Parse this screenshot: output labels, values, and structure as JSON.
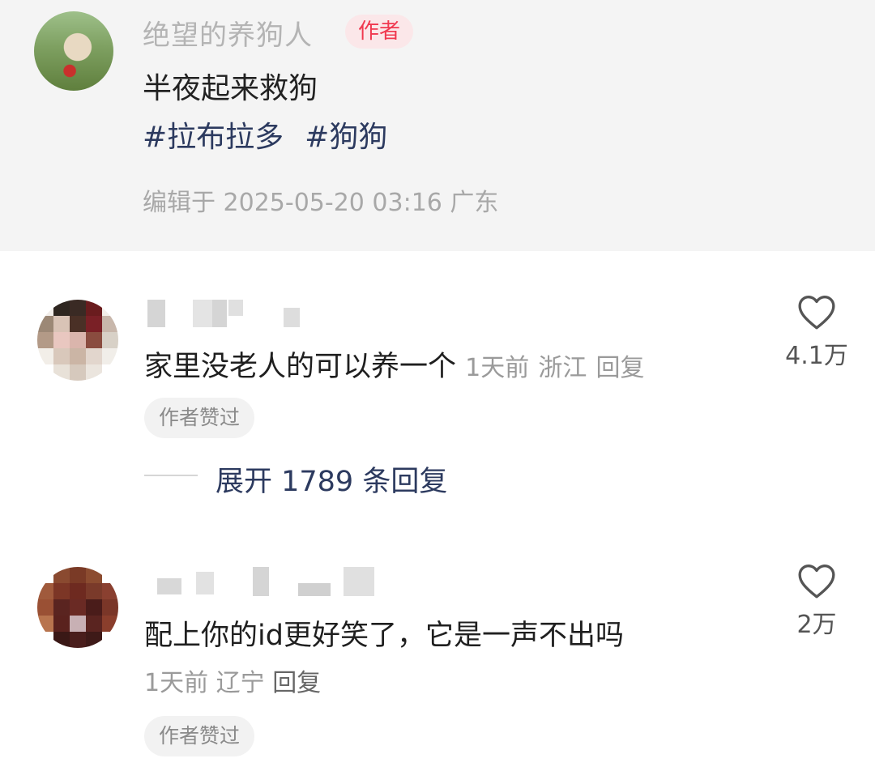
{
  "post": {
    "author_name": "绝望的养狗人",
    "author_badge": "作者",
    "text": "半夜起来救狗",
    "tags": [
      "#拉布拉多",
      "#狗狗"
    ],
    "edit_info": "编辑于  2025-05-20 03:16 广东"
  },
  "comments": [
    {
      "text": "家里没老人的可以养一个",
      "time": "1天前",
      "location": "浙江",
      "reply_label": "回复",
      "likes": "4.1万",
      "author_liked": "作者赞过",
      "expand_label": "展开 1789 条回复"
    },
    {
      "text": "配上你的id更好笑了，它是一声不出吗",
      "time": "1天前",
      "location": "辽宁",
      "reply_label": "回复",
      "likes": "2万",
      "author_liked": "作者赞过"
    }
  ],
  "icons": {
    "like": "heart-outline-icon"
  }
}
